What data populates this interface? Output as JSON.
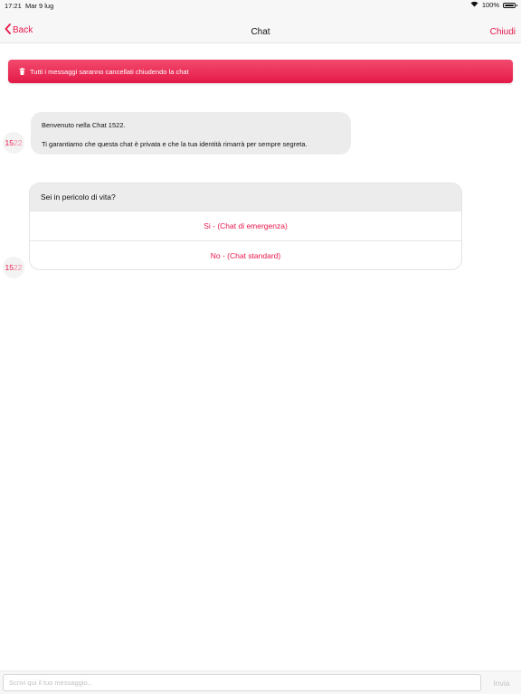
{
  "status_bar": {
    "time": "17:21",
    "date": "Mar 9 lug",
    "battery_text": "100%",
    "battery_level": 1.0
  },
  "nav": {
    "back_label": "Back",
    "title": "Chat",
    "close_label": "Chiudi"
  },
  "banner": {
    "text": "Tutti i messaggi saranno cancellati chiudendo la chat",
    "icon": "trash-icon"
  },
  "avatar": {
    "part1": "15",
    "part2": "2",
    "part3": "2"
  },
  "messages": [
    {
      "line1": "Benvenuto nella Chat 1522.",
      "line2": "Ti garantiamo che questa chat è privata e che la tua identità rimarrà per sempre segreta."
    }
  ],
  "question": {
    "text": "Sei in pericolo di vita?",
    "options": [
      "Si - (Chat di emergenza)",
      "No - (Chat standard)"
    ]
  },
  "input": {
    "placeholder": "Scrivi qui il tuo messaggio...",
    "value": "",
    "send_label": "Invia"
  },
  "colors": {
    "accent": "#e8174a",
    "bubble": "#ececec",
    "bar": "#f7f7f7"
  }
}
